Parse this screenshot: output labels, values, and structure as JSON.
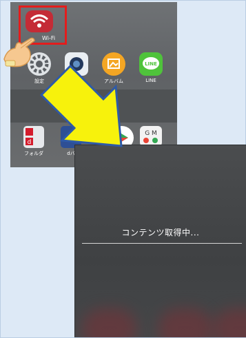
{
  "home_screen": {
    "wifi_app_label": "Wi-Fi",
    "apps_row": [
      {
        "label": "設定",
        "icon": "gear-icon"
      },
      {
        "label": "",
        "icon": "camera-icon"
      },
      {
        "label": "アルバム",
        "icon": "album-icon"
      },
      {
        "label": "LINE",
        "icon": "line-icon"
      }
    ],
    "apps_row2": [
      {
        "label": "フォルダ",
        "icon": "docomo-folder-icon"
      },
      {
        "label": "dバ",
        "icon": "docomo-icon"
      },
      {
        "label": "",
        "icon": "play-store-icon"
      },
      {
        "label": "",
        "icon": "google-apps-icon"
      }
    ],
    "line_icon_text": "LINE",
    "docomo_letter": "d",
    "gm_text": "G M"
  },
  "loading_screen": {
    "message": "コンテンツ取得中..."
  },
  "colors": {
    "highlight": "#e41c1c",
    "arrow_fill": "#f7f20c",
    "arrow_stroke": "#2e5aa8",
    "wifi_app": "#c42b36",
    "album_app": "#f4a623",
    "line_app": "#4fc33b"
  }
}
